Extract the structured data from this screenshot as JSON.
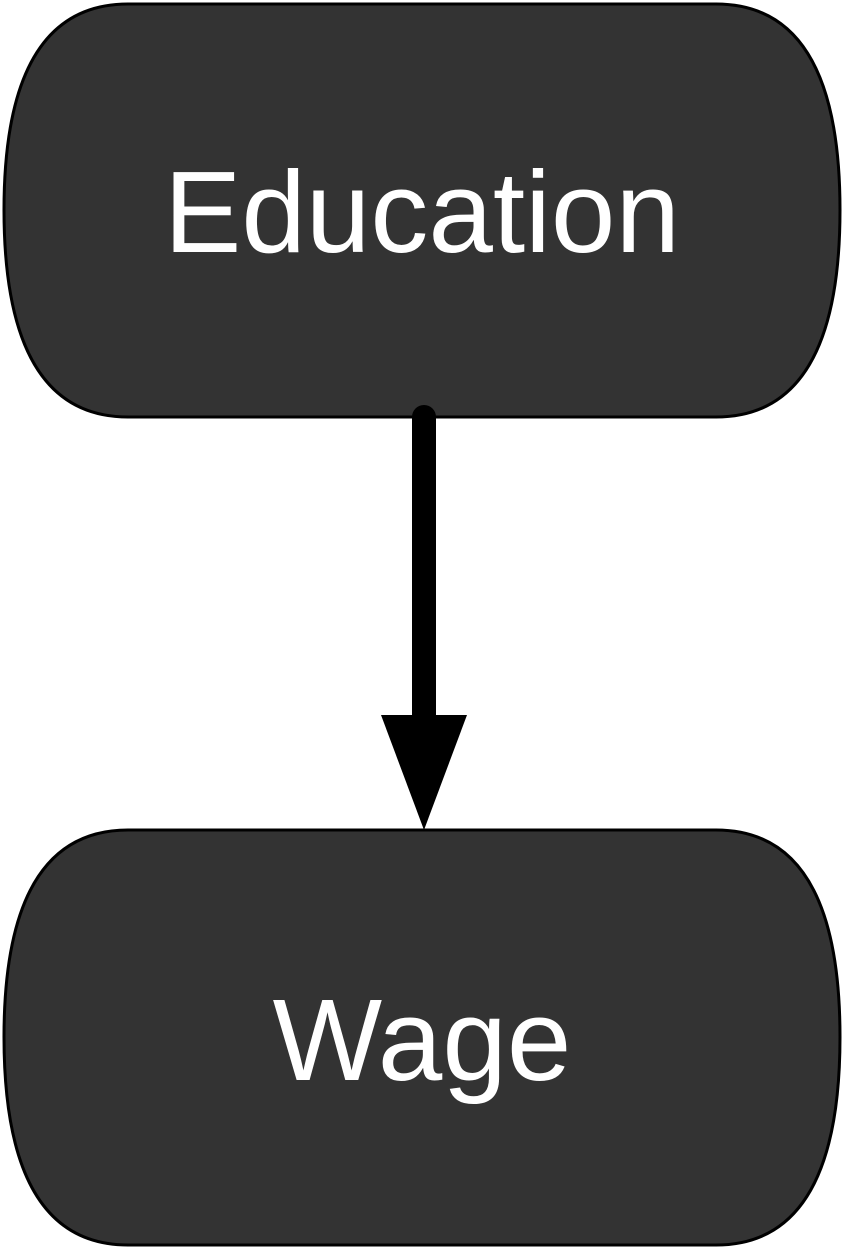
{
  "nodes": [
    {
      "id": "education",
      "label": "Education"
    },
    {
      "id": "wage",
      "label": "Wage"
    }
  ],
  "edges": [
    {
      "from": "education",
      "to": "wage"
    }
  ],
  "colors": {
    "node_fill": "#333333",
    "node_stroke": "#000000",
    "node_text": "#ffffff",
    "edge": "#000000",
    "background": "#ffffff"
  }
}
